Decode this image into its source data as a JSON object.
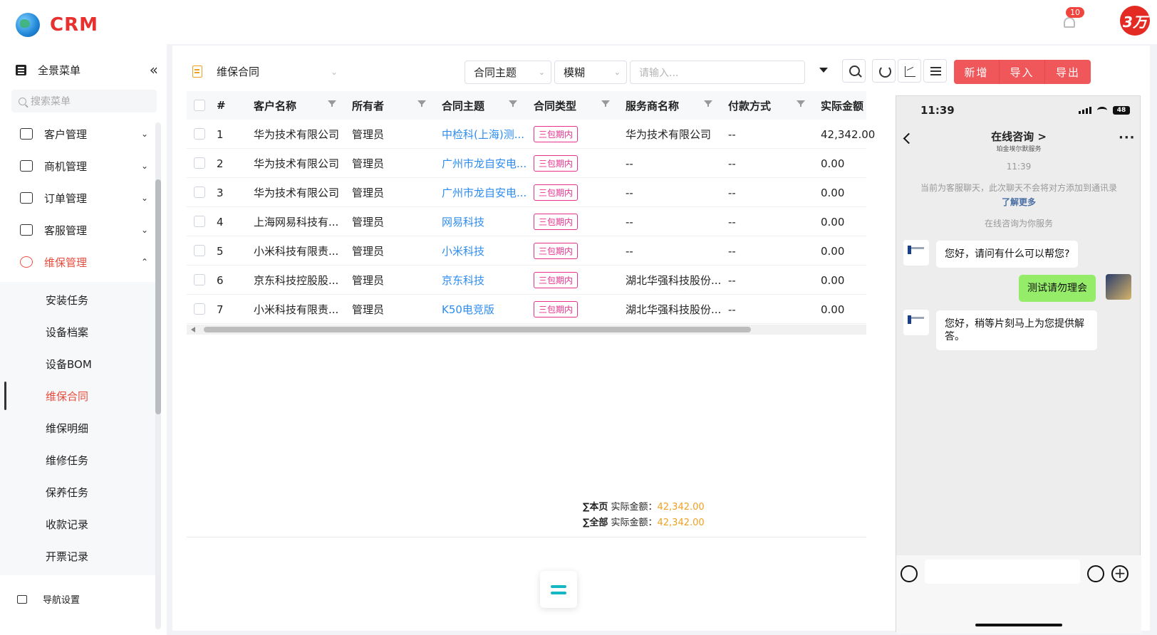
{
  "app": {
    "brand": "CRM",
    "notification_count": "10",
    "avatar_label": "3万"
  },
  "sidebar": {
    "header_label": "全景菜单",
    "collapse_glyph": "«",
    "search_placeholder": "搜索菜单",
    "groups": [
      {
        "label": "客户管理",
        "expanded": false
      },
      {
        "label": "商机管理",
        "expanded": false
      },
      {
        "label": "订单管理",
        "expanded": false
      },
      {
        "label": "客服管理",
        "expanded": false
      },
      {
        "label": "维保管理",
        "expanded": true
      }
    ],
    "sub_items": [
      "安装任务",
      "设备档案",
      "设备BOM",
      "维保合同",
      "维保明细",
      "维修任务",
      "保养任务",
      "收款记录",
      "开票记录"
    ],
    "active_sub": "维保合同",
    "footer_label": "导航设置"
  },
  "toolbar": {
    "view_label": "维保合同",
    "field_select": "合同主题",
    "match_select": "模糊",
    "search_placeholder": "请输入...",
    "buttons": [
      "新增",
      "导入",
      "导出"
    ]
  },
  "table": {
    "headers": [
      "#",
      "客户名称",
      "所有者",
      "合同主题",
      "合同类型",
      "服务商名称",
      "付款方式",
      "实际金额"
    ],
    "rows": [
      {
        "no": "1",
        "customer": "华为技术有限公司",
        "owner": "管理员",
        "subject": "中检科(上海)测...",
        "type": "三包期内",
        "provider": "华为技术有限公司",
        "payment": "--",
        "amount": "42,342.00"
      },
      {
        "no": "2",
        "customer": "华为技术有限公司",
        "owner": "管理员",
        "subject": "广州市龙自安电...",
        "type": "三包期内",
        "provider": "--",
        "payment": "--",
        "amount": "0.00"
      },
      {
        "no": "3",
        "customer": "华为技术有限公司",
        "owner": "管理员",
        "subject": "广州市龙自安电...",
        "type": "三包期内",
        "provider": "--",
        "payment": "--",
        "amount": "0.00"
      },
      {
        "no": "4",
        "customer": "上海网易科技有...",
        "owner": "管理员",
        "subject": "网易科技",
        "type": "三包期内",
        "provider": "--",
        "payment": "--",
        "amount": "0.00"
      },
      {
        "no": "5",
        "customer": "小米科技有限责...",
        "owner": "管理员",
        "subject": "小米科技",
        "type": "三包期内",
        "provider": "--",
        "payment": "--",
        "amount": "0.00"
      },
      {
        "no": "6",
        "customer": "京东科技控股股...",
        "owner": "管理员",
        "subject": "京东科技",
        "type": "三包期内",
        "provider": "湖北华强科技股份...",
        "payment": "--",
        "amount": "0.00"
      },
      {
        "no": "7",
        "customer": "小米科技有限责...",
        "owner": "管理员",
        "subject": "K50电竞版",
        "type": "三包期内",
        "provider": "湖北华强科技股份...",
        "payment": "--",
        "amount": "0.00"
      }
    ]
  },
  "summary": {
    "page_label": "∑本页",
    "all_label": "∑全部",
    "field_label": "实际金额：",
    "page_amount": "42,342.00",
    "all_amount": "42,342.00"
  },
  "chat": {
    "time": "11:39",
    "battery": "48",
    "title": "在线咨询 >",
    "subtitle": "珀金埃尔默服务",
    "more": "···",
    "timestamp": "11:39",
    "notice": "当前为客服聊天，此次聊天不会将对方添加到通讯录",
    "learn_more": "了解更多",
    "service_line": "在线咨询为你服务",
    "messages": [
      {
        "from": "agent",
        "text": "您好，请问有什么可以帮您?"
      },
      {
        "from": "me",
        "text": "测试请勿理会"
      },
      {
        "from": "agent",
        "text": "您好，稍等片刻马上为您提供解答。"
      }
    ]
  }
}
